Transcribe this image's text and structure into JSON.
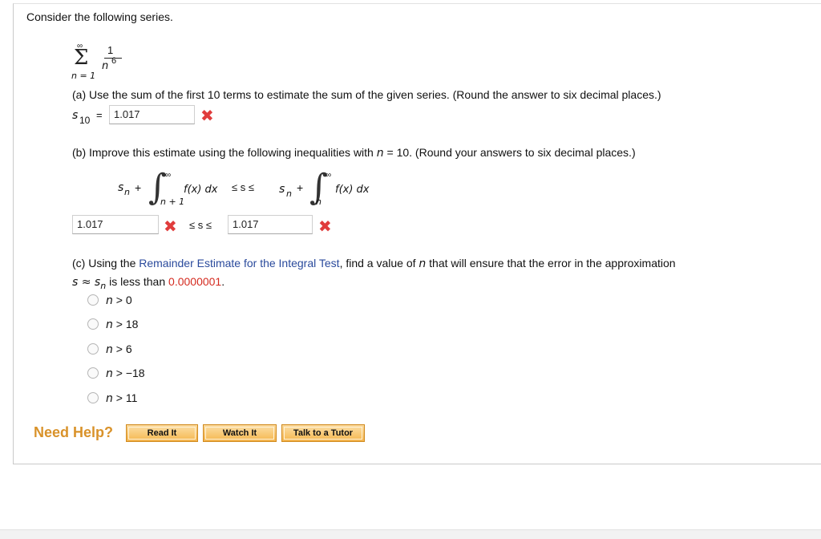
{
  "intro": "Consider the following series.",
  "series": {
    "upper": "∞",
    "numerator": "1",
    "denominator_var": "n",
    "denominator_exp": "6",
    "lower": "n = 1"
  },
  "part_a": {
    "text": "(a) Use the sum of the first 10 terms to estimate the sum of the given series. (Round the answer to six decimal places.)",
    "label_var": "s",
    "label_sub": "10",
    "equals": "=",
    "answer": "1.017"
  },
  "part_b": {
    "text_prefix": "(b) Improve this estimate using the following inequalities with ",
    "text_var": "n",
    "text_suffix": " = 10. (Round your answers to six decimal places.)",
    "formula": {
      "sn_left": "s",
      "sub_n": "n",
      "plus": "+",
      "inf": "∞",
      "lower_left": "n + 1",
      "fx": "f(x) dx",
      "leq_chain": "≤ s ≤",
      "lower_right": "n"
    },
    "answer_left": "1.017",
    "leq_between": "≤ s ≤",
    "answer_right": "1.017"
  },
  "part_c": {
    "text_prefix": "(c) Using the ",
    "link": "Remainder Estimate for the Integral Test",
    "text_mid": ", find a value of ",
    "text_var": "n",
    "text_suffix": " that will ensure that the error in the approximation",
    "line2_s": "s ≈ s",
    "line2_sub": "n",
    "line2_text": " is less than ",
    "threshold": "0.0000001",
    "period": ".",
    "options": [
      {
        "var": "n",
        "rest": " > 0"
      },
      {
        "var": "n",
        "rest": " > 18"
      },
      {
        "var": "n",
        "rest": " > 6"
      },
      {
        "var": "n",
        "rest": " > −18"
      },
      {
        "var": "n",
        "rest": " > 11"
      }
    ]
  },
  "help": {
    "label": "Need Help?",
    "read_it": "Read It",
    "watch_it": "Watch It",
    "talk": "Talk to a Tutor"
  },
  "colors": {
    "wrong": "#e03c3c",
    "link": "#2a4a9c",
    "threshold": "#d42b20",
    "need_help": "#d9922a"
  }
}
